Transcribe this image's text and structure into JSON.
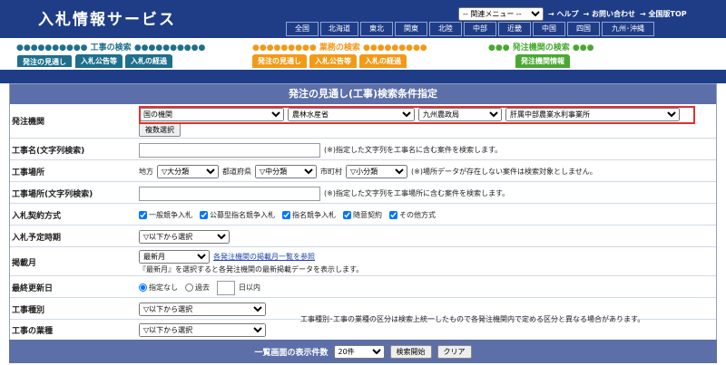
{
  "header": {
    "site_title": "入札情報サービス",
    "menu_select": "-- 関連メニュー --",
    "links": [
      "→ ヘルプ",
      "→ お問い合わせ",
      "→ 全国版TOP"
    ],
    "regions": [
      "全国",
      "北海道",
      "東北",
      "関東",
      "北陸",
      "中部",
      "近畿",
      "中国",
      "四国",
      "九州･沖縄"
    ]
  },
  "tab_groups": [
    {
      "title": "工事の検索",
      "tabs": [
        "発注の見通し",
        "入札公告等",
        "入札の経過"
      ]
    },
    {
      "title": "業務の検索",
      "tabs": [
        "発注の見通し",
        "入札公告等",
        "入札の経過"
      ]
    },
    {
      "title": "発注機関の検索",
      "tabs": [
        "発注機関情報"
      ]
    }
  ],
  "colors": {
    "navy": "#1f3d87",
    "teal": "#1e6f8c",
    "orange": "#f29a17",
    "green": "#4aa832",
    "panel_head": "#5c6fa8",
    "highlight": "#e03030"
  },
  "panel_title": "発注の見通し(工事)検索条件指定",
  "org": {
    "label": "発注機関",
    "selects": [
      "国の機関",
      "農林水産省",
      "九州農政局",
      "肝属中部農業水利事業所"
    ],
    "multi_button": "複数選択"
  },
  "work_name": {
    "label": "工事名(文字列検索)",
    "note": "(※)指定した文字列を工事名に含む案件を検索します。"
  },
  "location": {
    "label": "工事場所",
    "region_label": "地方",
    "region_value": "▽大分類",
    "pref_label": "都道府県",
    "pref_value": "▽中分類",
    "city_label": "市町村",
    "city_value": "▽小分類",
    "note": "(※)場所データが存在しない案件は検索対象としません。"
  },
  "location_text": {
    "label": "工事場所(文字列検索)",
    "note": "(※)指定した文字列を工事場所に含む案件を検索します。"
  },
  "contract": {
    "label": "入札契約方式",
    "options": [
      "一般競争入札",
      "公募型指名競争入札",
      "指名競争入札",
      "随意契約",
      "その他方式"
    ]
  },
  "schedule": {
    "label": "入札予定時期",
    "value": "▽以下から選択"
  },
  "period": {
    "label": "掲載月",
    "value": "最新月",
    "link": "各発注機関の掲載月一覧を参照",
    "note": "『最新月』を選択すると各発注機関の最新掲載データを表示します。"
  },
  "updated": {
    "label": "最終更新日",
    "opt1": "指定なし",
    "opt2": "過去",
    "unit": "日以内"
  },
  "work_type": {
    "label": "工事種別",
    "value": "▽以下から選択"
  },
  "work_category": {
    "label": "工事の業種",
    "value": "▽以下から選択",
    "note": "工事種別･工事の業種の区分は検索上統一したもので各発注機関内で定める区分と異なる場合があります。"
  },
  "footer": {
    "label": "一覧画面の表示件数",
    "count": "20件",
    "search": "検索開始",
    "clear": "クリア"
  }
}
